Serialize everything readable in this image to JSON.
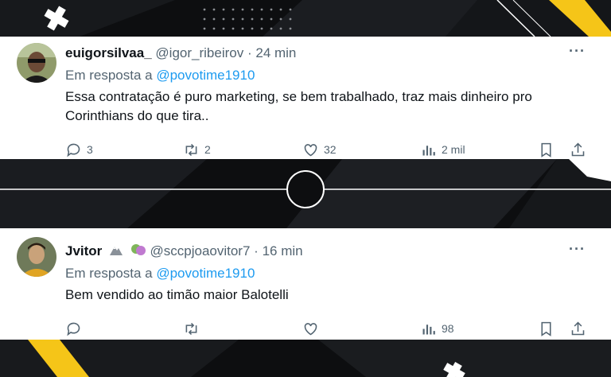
{
  "tweets": [
    {
      "display_name": "euigorsilvaa_",
      "handle": "@igor_ribeirov",
      "time": "24 min",
      "reply_prefix": "Em resposta a",
      "reply_to": "@povotime1910",
      "text": "Essa contratação é puro marketing, se bem trabalhado, traz mais dinheiro pro Corinthians do que tira..",
      "replies": "3",
      "retweets": "2",
      "likes": "32",
      "views": "2 mil",
      "more": "···"
    },
    {
      "display_name": "Jvitor",
      "handle": "@sccpjoaovitor7",
      "time": "16 min",
      "reply_prefix": "Em resposta a",
      "reply_to": "@povotime1910",
      "text": "Bem vendido ao timão maior Balotelli",
      "replies": "",
      "retweets": "",
      "likes": "",
      "views": "98",
      "more": "···"
    }
  ],
  "colors": {
    "background": "#0d0e10",
    "accent_yellow": "#f5c518",
    "link": "#1d9bf0",
    "muted": "#536471",
    "text": "#0f1419"
  },
  "icons": [
    "reply-icon",
    "retweet-icon",
    "like-icon",
    "views-icon",
    "bookmark-icon",
    "share-icon",
    "more-icon"
  ]
}
